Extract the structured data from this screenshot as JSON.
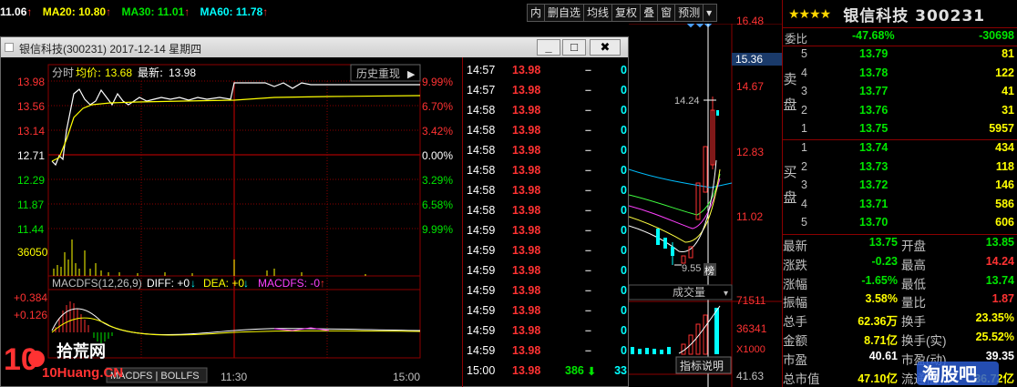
{
  "ma_bar": {
    "ma10_val": "11.06",
    "ma20_label": "MA20:",
    "ma20_val": "10.80",
    "ma30_label": "MA30:",
    "ma30_val": "11.01",
    "ma60_label": "MA60:",
    "ma60_val": "11.78",
    "arrow": "↑"
  },
  "toolbar": [
    "内",
    "删自选",
    "均线",
    "复权",
    "叠",
    "窗",
    "预测"
  ],
  "kline_axis": [
    "16.48",
    "15.36",
    "14.67",
    "12.83",
    "11.02",
    "71511",
    "36341",
    "X1000",
    "41.63"
  ],
  "kline": {
    "peak_label": "14.24",
    "low_label": "9.55",
    "low_tag": "榜",
    "vol_menu": "成交量",
    "indicator_btn": "指标说明"
  },
  "quote": {
    "stars": "★★★★",
    "name": "银信科技",
    "code": "300231",
    "weibi_label": "委比",
    "weibi_pct": "-47.68%",
    "weibi_diff": "-30698",
    "sell_label": "卖盘",
    "buy_label": "买盘",
    "sells": [
      {
        "lvl": "5",
        "price": "13.79",
        "vol": "81"
      },
      {
        "lvl": "4",
        "price": "13.78",
        "vol": "122"
      },
      {
        "lvl": "3",
        "price": "13.77",
        "vol": "41"
      },
      {
        "lvl": "2",
        "price": "13.76",
        "vol": "31"
      },
      {
        "lvl": "1",
        "price": "13.75",
        "vol": "5957"
      }
    ],
    "buys": [
      {
        "lvl": "1",
        "price": "13.74",
        "vol": "434"
      },
      {
        "lvl": "2",
        "price": "13.73",
        "vol": "118"
      },
      {
        "lvl": "3",
        "price": "13.72",
        "vol": "146"
      },
      {
        "lvl": "4",
        "price": "13.71",
        "vol": "586"
      },
      {
        "lvl": "5",
        "price": "13.70",
        "vol": "606"
      }
    ],
    "stats": [
      {
        "l": "最新",
        "v": "13.75",
        "vc": "green",
        "l2": "开盘",
        "v2": "13.85",
        "v2c": "green"
      },
      {
        "l": "涨跌",
        "v": "-0.23",
        "vc": "green",
        "l2": "最高",
        "v2": "14.24",
        "v2c": "red"
      },
      {
        "l": "涨幅",
        "v": "-1.65%",
        "vc": "green",
        "l2": "最低",
        "v2": "13.74",
        "v2c": "green"
      },
      {
        "l": "振幅",
        "v": "3.58%",
        "vc": "yellow",
        "l2": "量比",
        "v2": "1.87",
        "v2c": "red"
      },
      {
        "l": "总手",
        "v": "62.36万",
        "vc": "yellow",
        "l2": "换手",
        "v2": "23.35%",
        "v2c": "yellow"
      },
      {
        "l": "金额",
        "v": "8.71亿",
        "vc": "yellow",
        "l2": "换手(实)",
        "v2": "25.52%",
        "v2c": "yellow"
      },
      {
        "l": "市盈",
        "v": "40.61",
        "vc": "white",
        "l2": "市盈(动)",
        "v2": "39.35",
        "v2c": "white"
      },
      {
        "l": "总市值",
        "v": "47.10亿",
        "vc": "yellow",
        "l2": "流通值",
        "v2": "36.72亿",
        "v2c": "yellow"
      }
    ]
  },
  "window": {
    "title": "银信科技(300231) 2017-12-14 星期四",
    "btn_min": "_",
    "btn_max": "□",
    "btn_close": "✖"
  },
  "intraday": {
    "header_fenshi": "分时",
    "header_avg_label": "均价:",
    "header_avg": "13.68",
    "header_last_label": "最新:",
    "header_last": "13.98",
    "history_btn": "历史重现",
    "left_axis": [
      "13.98",
      "13.56",
      "13.14",
      "12.71",
      "12.29",
      "11.87",
      "11.44"
    ],
    "right_axis": [
      "9.99%",
      "6.70%",
      "3.42%",
      "0.00%",
      "3.29%",
      "6.58%",
      "9.99%"
    ],
    "vol_label": "36050",
    "macd_left": [
      "+0.384",
      "+0.126"
    ],
    "macd_title": "MACDFS(12,26,9)",
    "macd_diff": "DIFF: +0",
    "macd_dea": "DEA: +0",
    "macd_macdfs": "MACDFS: -0",
    "time_mid": "11:30",
    "time_end": "15:00",
    "bottom_tabs": "MACDFS | BOLLFS"
  },
  "trades": [
    {
      "t": "14:57",
      "p": "13.98",
      "d": "–",
      "v": "0"
    },
    {
      "t": "14:57",
      "p": "13.98",
      "d": "–",
      "v": "0"
    },
    {
      "t": "14:58",
      "p": "13.98",
      "d": "–",
      "v": "0"
    },
    {
      "t": "14:58",
      "p": "13.98",
      "d": "–",
      "v": "0"
    },
    {
      "t": "14:58",
      "p": "13.98",
      "d": "–",
      "v": "0"
    },
    {
      "t": "14:58",
      "p": "13.98",
      "d": "–",
      "v": "0"
    },
    {
      "t": "14:58",
      "p": "13.98",
      "d": "–",
      "v": "0"
    },
    {
      "t": "14:58",
      "p": "13.98",
      "d": "–",
      "v": "0"
    },
    {
      "t": "14:59",
      "p": "13.98",
      "d": "–",
      "v": "0"
    },
    {
      "t": "14:59",
      "p": "13.98",
      "d": "–",
      "v": "0"
    },
    {
      "t": "14:59",
      "p": "13.98",
      "d": "–",
      "v": "0"
    },
    {
      "t": "14:59",
      "p": "13.98",
      "d": "–",
      "v": "0"
    },
    {
      "t": "14:59",
      "p": "13.98",
      "d": "–",
      "v": "0"
    },
    {
      "t": "14:59",
      "p": "13.98",
      "d": "–",
      "v": "0"
    },
    {
      "t": "14:59",
      "p": "13.98",
      "d": "–",
      "v": "0"
    },
    {
      "t": "15:00",
      "p": "13.98",
      "d": "386",
      "v": "33"
    }
  ],
  "watermark": {
    "num": "10",
    "cn": "拾荒网",
    "en": "10Huang.CN"
  },
  "watermark2": "淘股吧",
  "colors": {
    "up": "#ff3232",
    "down": "#00e600",
    "price_line": "#ffffff",
    "avg_line": "#ffff00",
    "grid": "#8b0000"
  }
}
